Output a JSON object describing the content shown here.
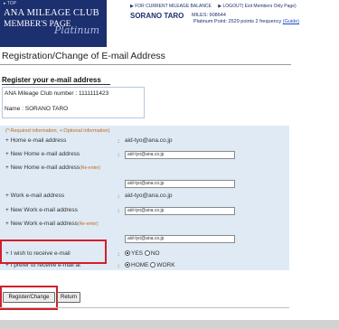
{
  "header": {
    "top_link": "▸ TOP",
    "brand_line1": "ANA MILEAGE CLUB",
    "brand_line2": "MEMBER'S PAGE",
    "tier": "Platinum",
    "link_balance": "▶ FOR CURRENT MILEAGE BALANCE",
    "link_logout": "▶ LOGOUT( Exit Members Only Page)",
    "member_name": "SORANO TARO",
    "miles": "MILES: 908644",
    "points_text": "Platinum Point: 2529 points 2 frequency",
    "guide_link": "(Guide)"
  },
  "page_title": "Registration/Change of E-mail Address",
  "register": {
    "heading": "Register your e-mail address",
    "number_label": "ANA Mileage Club number : 1111111423",
    "name_label": "Name : SORANO TARO"
  },
  "form": {
    "legend": "(*:Required information, +:Optional information)",
    "home_email": {
      "label": "+ Home e-mail address",
      "colon": ":",
      "value": "aid-tyo@ana.co.jp"
    },
    "new_home_email": {
      "label": "+ New Home e-mail address",
      "colon": ":",
      "input": "aid-tyo@ana.co.jp"
    },
    "new_home_email_reenter": {
      "label": "+ New Home e-mail address",
      "note": "(Re-enter)",
      "input": "aid-tyo@ana.co.jp"
    },
    "work_email": {
      "label": "+ Work e-mail address",
      "colon": ":",
      "value": "aid-tyo@ana.co.jp"
    },
    "new_work_email": {
      "label": "+ New Work e-mail address",
      "colon": ":",
      "input": "aid-tyo@ana.co.jp"
    },
    "new_work_email_reenter": {
      "label": "+ New Work e-mail address",
      "note": "(Re-enter)",
      "input": "aid-tyo@ana.co.jp"
    },
    "receive_email": {
      "label": "+ I wish to receive e-mail",
      "colon": ":",
      "yes": "YES",
      "no": "NO",
      "selected": "YES"
    },
    "prefer_email": {
      "label": "+ I prefer to receive e-mail at",
      "colon": ":",
      "home": "HOME",
      "work": "WORK",
      "selected": "HOME"
    }
  },
  "buttons": {
    "register_change": "Register/Change",
    "return": "Return"
  },
  "colors": {
    "brand_navy": "#1c2f6e",
    "form_bg": "#dfeaf5",
    "required_orange": "#c06a16",
    "highlight_red": "#d0202a"
  }
}
